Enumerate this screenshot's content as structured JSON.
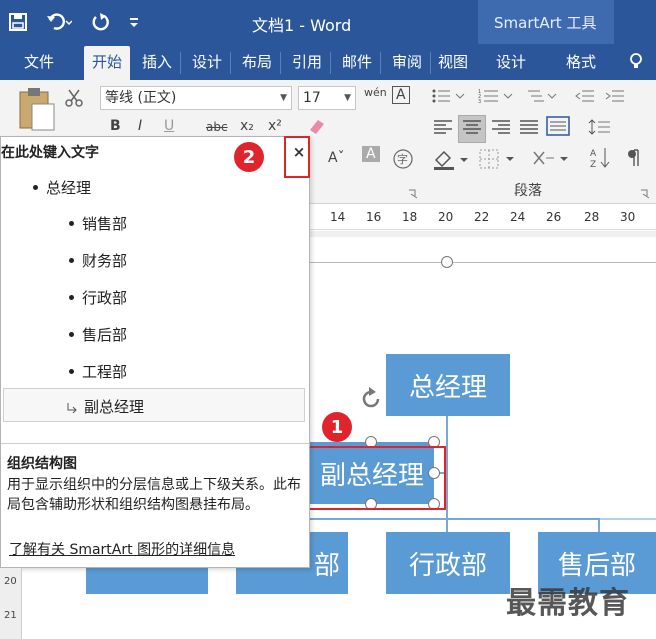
{
  "window": {
    "doc_title": "文档1 - Word",
    "context_tools": "SmartArt 工具"
  },
  "tabs": [
    "文件",
    "开始",
    "插入",
    "设计",
    "布局",
    "引用",
    "邮件",
    "审阅",
    "视图",
    "设计",
    "格式"
  ],
  "active_tab": "开始",
  "ribbon": {
    "font_name": "等线 (正文)",
    "font_size": "17",
    "paragraph_group": "段落",
    "format_buttons": [
      "B",
      "I",
      "U",
      "abc",
      "x₂",
      "x²"
    ]
  },
  "ruler": [
    "14",
    "16",
    "18",
    "20",
    "22",
    "24",
    "26",
    "28",
    "30"
  ],
  "vertical_ruler": [
    "20",
    "21"
  ],
  "text_pane": {
    "title": "在此处键入文字",
    "close_label": "×",
    "items": [
      {
        "text": "总经理",
        "level": 1
      },
      {
        "text": "销售部",
        "level": 2
      },
      {
        "text": "财务部",
        "level": 2
      },
      {
        "text": "行政部",
        "level": 2
      },
      {
        "text": "售后部",
        "level": 2
      },
      {
        "text": "工程部",
        "level": 2
      },
      {
        "text": "副总经理",
        "level": 2,
        "assistant": true
      }
    ],
    "desc_title": "组织结构图",
    "desc_body": "用于显示组织中的分层信息或上下级关系。此布局包含辅助形状和组织结构图悬挂布局。",
    "desc_link": "了解有关 SmartArt 图形的详细信息"
  },
  "chart": {
    "top": "总经理",
    "assistant": "副总经理",
    "bottom_left_partial": "部",
    "bottom_mid": "行政部",
    "bottom_right": "售后部"
  },
  "badges": [
    "1",
    "2"
  ],
  "watermark": "最需教育",
  "colors": {
    "title_bar": "#2b579a",
    "smartart_box": "#5b9bd5",
    "highlight_red": "#e0242c"
  }
}
